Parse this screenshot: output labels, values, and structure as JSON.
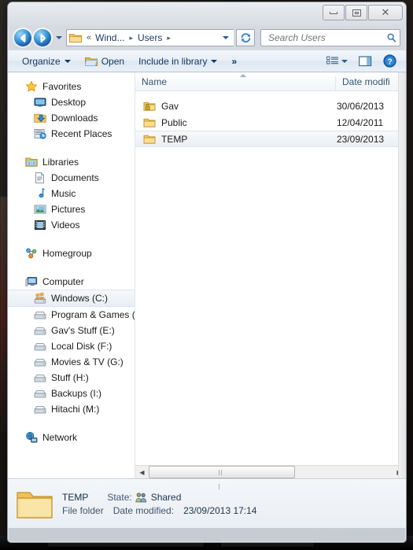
{
  "window": {
    "controls": {
      "minimize": "Minimize",
      "maximize": "Maximize",
      "close": "Close"
    }
  },
  "addressbar": {
    "back": "Back",
    "forward": "Forward",
    "history": "Recent pages",
    "overflow_chevron": "«",
    "crumbs": [
      {
        "label": "Wind...",
        "sep": "▸"
      },
      {
        "label": "Users",
        "sep": "▸"
      }
    ],
    "refresh": "Refresh",
    "search_placeholder": "Search Users",
    "search_value": ""
  },
  "toolbar": {
    "organize": "Organize",
    "open": "Open",
    "include_in_library": "Include in library",
    "overflow": "»",
    "view_options": "Change your view",
    "preview_pane": "Show the preview pane",
    "help": "Help"
  },
  "navpane": {
    "groups": [
      {
        "name": "favorites",
        "root": {
          "label": "Favorites",
          "icon": "star-icon"
        },
        "items": [
          {
            "label": "Desktop",
            "icon": "desktop-icon"
          },
          {
            "label": "Downloads",
            "icon": "downloads-icon"
          },
          {
            "label": "Recent Places",
            "icon": "recent-places-icon"
          }
        ]
      },
      {
        "name": "libraries",
        "root": {
          "label": "Libraries",
          "icon": "libraries-icon"
        },
        "items": [
          {
            "label": "Documents",
            "icon": "documents-icon"
          },
          {
            "label": "Music",
            "icon": "music-icon"
          },
          {
            "label": "Pictures",
            "icon": "pictures-icon"
          },
          {
            "label": "Videos",
            "icon": "videos-icon"
          }
        ]
      },
      {
        "name": "homegroup",
        "root": {
          "label": "Homegroup",
          "icon": "homegroup-icon"
        },
        "items": []
      },
      {
        "name": "computer",
        "root": {
          "label": "Computer",
          "icon": "computer-icon"
        },
        "items": [
          {
            "label": "Windows (C:)",
            "icon": "windows-drive-icon",
            "selected": true
          },
          {
            "label": "Program & Games (D",
            "icon": "drive-icon"
          },
          {
            "label": "Gav's Stuff (E:)",
            "icon": "drive-icon"
          },
          {
            "label": "Local Disk (F:)",
            "icon": "drive-icon"
          },
          {
            "label": "Movies & TV (G:)",
            "icon": "drive-icon"
          },
          {
            "label": "Stuff (H:)",
            "icon": "drive-icon"
          },
          {
            "label": "Backups (I:)",
            "icon": "drive-icon"
          },
          {
            "label": "Hitachi (M:)",
            "icon": "drive-icon"
          }
        ]
      },
      {
        "name": "network",
        "root": {
          "label": "Network",
          "icon": "network-icon"
        },
        "items": []
      }
    ]
  },
  "filelist": {
    "columns": [
      {
        "key": "name",
        "label": "Name",
        "sorted": "asc"
      },
      {
        "key": "date",
        "label": "Date modifi"
      }
    ],
    "rows": [
      {
        "name": "Gav",
        "date": "30/06/2013",
        "icon": "folder-private-icon",
        "selected": false
      },
      {
        "name": "Public",
        "date": "12/04/2011",
        "icon": "folder-icon",
        "selected": false
      },
      {
        "name": "TEMP",
        "date": "23/09/2013",
        "icon": "folder-icon",
        "selected": true
      }
    ]
  },
  "scrollbars": {
    "h_left_arrow": "◀",
    "h_right_arrow": "▶"
  },
  "details": {
    "name": "TEMP",
    "type": "File folder",
    "state_label": "State:",
    "state_value": "Shared",
    "date_label": "Date modified:",
    "date_value": "23/09/2013 17:14"
  }
}
